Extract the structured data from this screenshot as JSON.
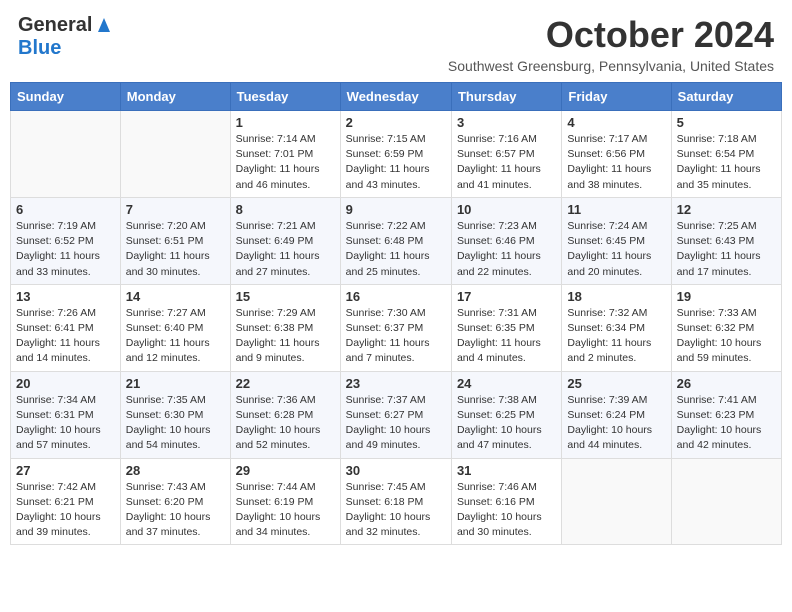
{
  "header": {
    "logo_general": "General",
    "logo_blue": "Blue",
    "month": "October 2024",
    "location": "Southwest Greensburg, Pennsylvania, United States"
  },
  "weekdays": [
    "Sunday",
    "Monday",
    "Tuesday",
    "Wednesday",
    "Thursday",
    "Friday",
    "Saturday"
  ],
  "weeks": [
    [
      {
        "day": "",
        "info": ""
      },
      {
        "day": "",
        "info": ""
      },
      {
        "day": "1",
        "info": "Sunrise: 7:14 AM\nSunset: 7:01 PM\nDaylight: 11 hours and 46 minutes."
      },
      {
        "day": "2",
        "info": "Sunrise: 7:15 AM\nSunset: 6:59 PM\nDaylight: 11 hours and 43 minutes."
      },
      {
        "day": "3",
        "info": "Sunrise: 7:16 AM\nSunset: 6:57 PM\nDaylight: 11 hours and 41 minutes."
      },
      {
        "day": "4",
        "info": "Sunrise: 7:17 AM\nSunset: 6:56 PM\nDaylight: 11 hours and 38 minutes."
      },
      {
        "day": "5",
        "info": "Sunrise: 7:18 AM\nSunset: 6:54 PM\nDaylight: 11 hours and 35 minutes."
      }
    ],
    [
      {
        "day": "6",
        "info": "Sunrise: 7:19 AM\nSunset: 6:52 PM\nDaylight: 11 hours and 33 minutes."
      },
      {
        "day": "7",
        "info": "Sunrise: 7:20 AM\nSunset: 6:51 PM\nDaylight: 11 hours and 30 minutes."
      },
      {
        "day": "8",
        "info": "Sunrise: 7:21 AM\nSunset: 6:49 PM\nDaylight: 11 hours and 27 minutes."
      },
      {
        "day": "9",
        "info": "Sunrise: 7:22 AM\nSunset: 6:48 PM\nDaylight: 11 hours and 25 minutes."
      },
      {
        "day": "10",
        "info": "Sunrise: 7:23 AM\nSunset: 6:46 PM\nDaylight: 11 hours and 22 minutes."
      },
      {
        "day": "11",
        "info": "Sunrise: 7:24 AM\nSunset: 6:45 PM\nDaylight: 11 hours and 20 minutes."
      },
      {
        "day": "12",
        "info": "Sunrise: 7:25 AM\nSunset: 6:43 PM\nDaylight: 11 hours and 17 minutes."
      }
    ],
    [
      {
        "day": "13",
        "info": "Sunrise: 7:26 AM\nSunset: 6:41 PM\nDaylight: 11 hours and 14 minutes."
      },
      {
        "day": "14",
        "info": "Sunrise: 7:27 AM\nSunset: 6:40 PM\nDaylight: 11 hours and 12 minutes."
      },
      {
        "day": "15",
        "info": "Sunrise: 7:29 AM\nSunset: 6:38 PM\nDaylight: 11 hours and 9 minutes."
      },
      {
        "day": "16",
        "info": "Sunrise: 7:30 AM\nSunset: 6:37 PM\nDaylight: 11 hours and 7 minutes."
      },
      {
        "day": "17",
        "info": "Sunrise: 7:31 AM\nSunset: 6:35 PM\nDaylight: 11 hours and 4 minutes."
      },
      {
        "day": "18",
        "info": "Sunrise: 7:32 AM\nSunset: 6:34 PM\nDaylight: 11 hours and 2 minutes."
      },
      {
        "day": "19",
        "info": "Sunrise: 7:33 AM\nSunset: 6:32 PM\nDaylight: 10 hours and 59 minutes."
      }
    ],
    [
      {
        "day": "20",
        "info": "Sunrise: 7:34 AM\nSunset: 6:31 PM\nDaylight: 10 hours and 57 minutes."
      },
      {
        "day": "21",
        "info": "Sunrise: 7:35 AM\nSunset: 6:30 PM\nDaylight: 10 hours and 54 minutes."
      },
      {
        "day": "22",
        "info": "Sunrise: 7:36 AM\nSunset: 6:28 PM\nDaylight: 10 hours and 52 minutes."
      },
      {
        "day": "23",
        "info": "Sunrise: 7:37 AM\nSunset: 6:27 PM\nDaylight: 10 hours and 49 minutes."
      },
      {
        "day": "24",
        "info": "Sunrise: 7:38 AM\nSunset: 6:25 PM\nDaylight: 10 hours and 47 minutes."
      },
      {
        "day": "25",
        "info": "Sunrise: 7:39 AM\nSunset: 6:24 PM\nDaylight: 10 hours and 44 minutes."
      },
      {
        "day": "26",
        "info": "Sunrise: 7:41 AM\nSunset: 6:23 PM\nDaylight: 10 hours and 42 minutes."
      }
    ],
    [
      {
        "day": "27",
        "info": "Sunrise: 7:42 AM\nSunset: 6:21 PM\nDaylight: 10 hours and 39 minutes."
      },
      {
        "day": "28",
        "info": "Sunrise: 7:43 AM\nSunset: 6:20 PM\nDaylight: 10 hours and 37 minutes."
      },
      {
        "day": "29",
        "info": "Sunrise: 7:44 AM\nSunset: 6:19 PM\nDaylight: 10 hours and 34 minutes."
      },
      {
        "day": "30",
        "info": "Sunrise: 7:45 AM\nSunset: 6:18 PM\nDaylight: 10 hours and 32 minutes."
      },
      {
        "day": "31",
        "info": "Sunrise: 7:46 AM\nSunset: 6:16 PM\nDaylight: 10 hours and 30 minutes."
      },
      {
        "day": "",
        "info": ""
      },
      {
        "day": "",
        "info": ""
      }
    ]
  ]
}
